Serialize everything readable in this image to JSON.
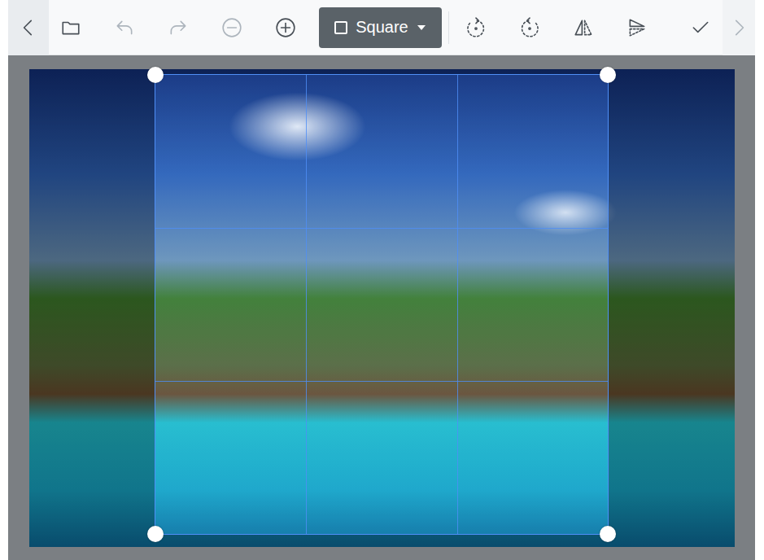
{
  "toolbar": {
    "left_tools": [
      {
        "kind": "back",
        "disabled": false
      },
      {
        "kind": "open",
        "disabled": false
      },
      {
        "kind": "undo",
        "disabled": true
      },
      {
        "kind": "redo",
        "disabled": true
      },
      {
        "kind": "zoomout",
        "disabled": true
      },
      {
        "kind": "zoomin",
        "disabled": false
      }
    ],
    "aspect": {
      "label": "Square"
    },
    "right_tools": [
      {
        "kind": "rotateleft",
        "disabled": false
      },
      {
        "kind": "rotateright",
        "disabled": false
      },
      {
        "kind": "fliphorizontal",
        "disabled": false
      },
      {
        "kind": "flipvertical",
        "disabled": false
      },
      {
        "kind": "apply",
        "disabled": false
      },
      {
        "kind": "forward",
        "disabled": true
      }
    ]
  }
}
